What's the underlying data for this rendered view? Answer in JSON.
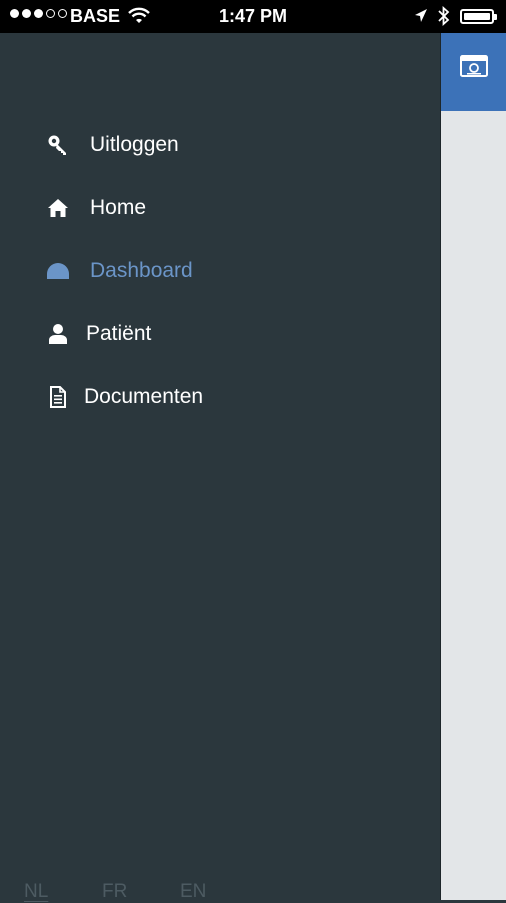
{
  "status_bar": {
    "carrier": "BASE",
    "time": "1:47 PM"
  },
  "menu": {
    "items": [
      {
        "label": "Uitloggen",
        "icon": "key-icon"
      },
      {
        "label": "Home",
        "icon": "home-icon"
      },
      {
        "label": "Dashboard",
        "icon": "dashboard-icon",
        "active": true
      },
      {
        "label": "Patiënt",
        "icon": "user-icon"
      },
      {
        "label": "Documenten",
        "icon": "document-icon"
      }
    ],
    "active_color": "#6b95c8"
  },
  "languages": [
    {
      "label": "NL",
      "selected": true
    },
    {
      "label": "FR"
    },
    {
      "label": "EN"
    }
  ],
  "colors": {
    "drawer_bg": "#2b373d",
    "accent": "#3c72b8"
  }
}
